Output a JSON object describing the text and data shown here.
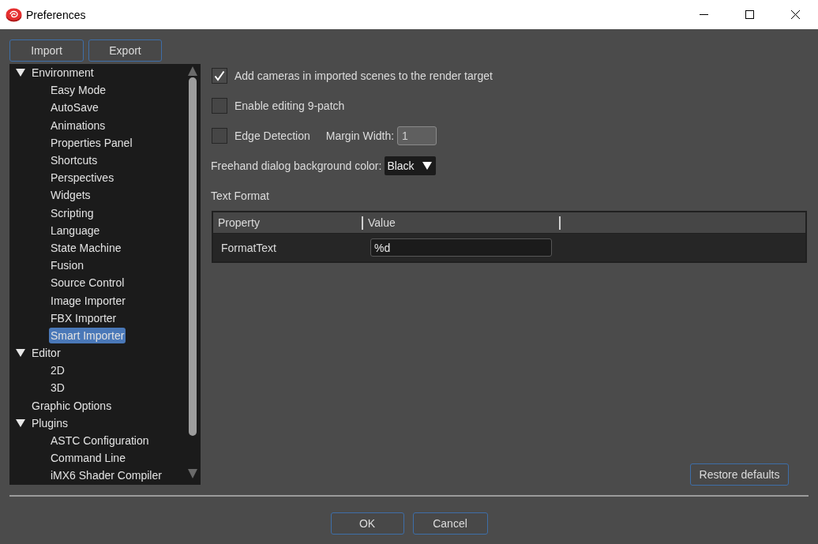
{
  "window": {
    "title": "Preferences"
  },
  "toolbar": {
    "buttons": [
      "Import",
      "Export"
    ]
  },
  "tree": {
    "items": [
      {
        "label": "Environment",
        "expanded": true,
        "selected": false,
        "children": [
          {
            "label": "Easy Mode",
            "selected": false
          },
          {
            "label": "AutoSave",
            "selected": false
          },
          {
            "label": "Animations",
            "selected": false
          },
          {
            "label": "Properties Panel",
            "selected": false
          },
          {
            "label": "Shortcuts",
            "selected": false
          },
          {
            "label": "Perspectives",
            "selected": false
          },
          {
            "label": "Widgets",
            "selected": false
          },
          {
            "label": "Scripting",
            "selected": false
          },
          {
            "label": "Language",
            "selected": false
          },
          {
            "label": "State Machine",
            "selected": false
          },
          {
            "label": "Fusion",
            "selected": false
          },
          {
            "label": "Source Control",
            "selected": false
          },
          {
            "label": "Image Importer",
            "selected": false
          },
          {
            "label": "FBX Importer",
            "selected": false
          },
          {
            "label": "Smart Importer",
            "selected": true
          }
        ]
      },
      {
        "label": "Editor",
        "expanded": true,
        "selected": false,
        "children": [
          {
            "label": "2D",
            "selected": false
          },
          {
            "label": "3D",
            "selected": false
          }
        ]
      },
      {
        "label": "Graphic Options",
        "selected": false
      },
      {
        "label": "Plugins",
        "expanded": true,
        "selected": false,
        "children": [
          {
            "label": "ASTC Configuration",
            "selected": false
          },
          {
            "label": "Command Line",
            "selected": false
          },
          {
            "label": "iMX6 Shader Compiler",
            "selected": false
          }
        ]
      }
    ]
  },
  "options": [
    {
      "kind": "checkbox",
      "label": "Add cameras in imported scenes to the render target",
      "checked": true
    },
    {
      "kind": "checkbox",
      "label": "Enable editing 9-patch",
      "checked": false
    },
    {
      "kind": "checkbox_field",
      "label": "Edge Detection",
      "checked": false,
      "field_label": "Margin Width:",
      "field_value": "1"
    },
    {
      "kind": "dropdown",
      "label": "Freehand dialog background color:",
      "value": "Black"
    }
  ],
  "text_format": {
    "title": "Text Format",
    "columns": [
      "Property",
      "Value"
    ],
    "rows": [
      {
        "property": "FormatText",
        "value": "%d"
      }
    ]
  },
  "restore_button": "Restore defaults",
  "dialog_buttons": [
    "OK",
    "Cancel"
  ]
}
